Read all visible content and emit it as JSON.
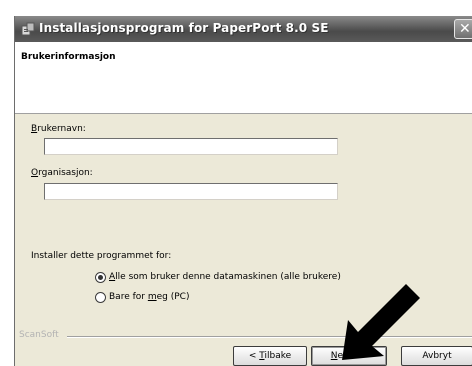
{
  "window": {
    "title": "Installasjonsprogram for PaperPort 8.0 SE",
    "close_glyph": "✕"
  },
  "banner": {
    "title": "Brukerinformasjon"
  },
  "form": {
    "username": {
      "label_u": "B",
      "label_rest": "rukernavn:",
      "value": ""
    },
    "organization": {
      "label_u": "O",
      "label_rest": "rganisasjon:",
      "value": ""
    },
    "install_for_label": "Installer dette programmet for:",
    "options": [
      {
        "pre": "",
        "u": "A",
        "rest": "lle som bruker denne datamaskinen (alle brukere)",
        "selected": true
      },
      {
        "pre": "Bare for ",
        "u": "m",
        "rest": "eg (PC)",
        "selected": false
      }
    ]
  },
  "footer": {
    "brand": "ScanSoft",
    "back": {
      "pre": "< ",
      "u": "T",
      "rest": "ilbake"
    },
    "next": {
      "pre": "",
      "u": "N",
      "rest": "este >"
    },
    "cancel": "Avbryt"
  },
  "icons": {
    "window_icon": "installer-icon",
    "pointer": "arrow-pointer-icon"
  }
}
